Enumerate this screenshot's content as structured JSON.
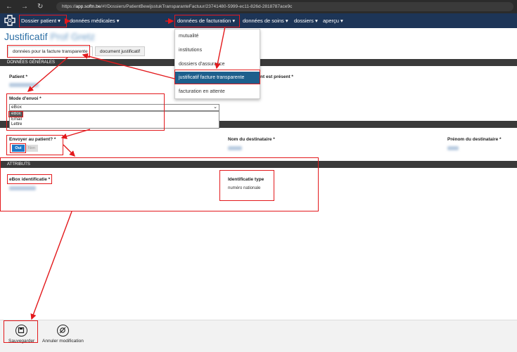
{
  "browser": {
    "url_prefix": "https://",
    "url_host": "app.softn.be",
    "url_path": "/#!/Dossiers/PatientBewijsstukTransparanteFactuur/23741480-5999-ec11-826d-2818787ace9c"
  },
  "nav": {
    "items": [
      {
        "label": "Dossier patient ▾"
      },
      {
        "label": "données médicales ▾"
      },
      {
        "label": "données de facturation ▾"
      },
      {
        "label": "données de soins ▾"
      },
      {
        "label": "dossiers ▾"
      },
      {
        "label": "aperçu ▾"
      }
    ]
  },
  "facturation_menu": {
    "items": [
      {
        "label": "mutualité"
      },
      {
        "label": "institutions"
      },
      {
        "label": "dossiers d'assurance"
      },
      {
        "label": "justificatif facture transparente"
      },
      {
        "label": "facturation en attente"
      }
    ]
  },
  "page": {
    "title": "Justificatif",
    "title_blurred": "Prof Gretz",
    "tabs": [
      {
        "label": "données pour la facture transparente"
      },
      {
        "label": "document justificatif"
      }
    ]
  },
  "sections": {
    "general": "DONNÉES GÉNÉRALES",
    "attributes": "ATTRIBUTS"
  },
  "fields": {
    "patient_label": "Patient *",
    "present_label": "nt est présent *",
    "mode_label": "Mode d'envoi *",
    "mode_value": "eBox",
    "mode_options": [
      "eBox",
      "Email",
      "Lettre"
    ],
    "send_label": "Envoyer au patient? *",
    "oui": "Oui",
    "non": "Non",
    "recipient_name_label": "Nom du destinataire *",
    "recipient_first_label": "Prénom du destinataire *",
    "ebox_id_label": "eBox identificatie *",
    "id_type_label": "Identificatie type",
    "id_type_value": "numéro nationale"
  },
  "bottom": {
    "save": "Sauvegarder",
    "cancel": "Annuler modification"
  },
  "colors": {
    "nav_bg": "#1d3557",
    "accent": "#1f78c8",
    "annotation": "#e3191c",
    "highlight": "#1d5f8c"
  }
}
